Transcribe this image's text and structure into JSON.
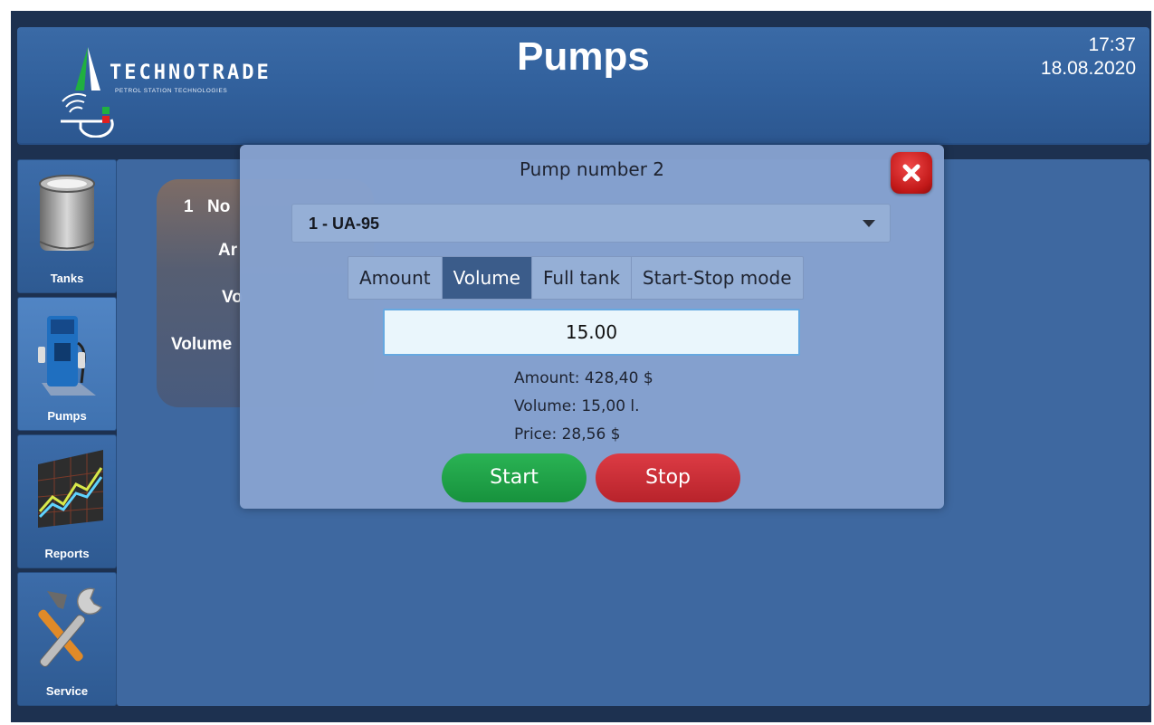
{
  "header": {
    "brand_name": "TECHNOTRADE",
    "brand_tagline": "PETROL STATION TECHNOLOGIES",
    "title": "Pumps",
    "time": "17:37",
    "date": "18.08.2020"
  },
  "sidebar": {
    "items": [
      {
        "label": "Tanks",
        "icon": "tank-icon"
      },
      {
        "label": "Pumps",
        "icon": "fuel-pump-icon",
        "active": true
      },
      {
        "label": "Reports",
        "icon": "chart-icon"
      },
      {
        "label": "Service",
        "icon": "tools-icon"
      }
    ]
  },
  "pump_card": {
    "number": "1",
    "nozzle_label": "No",
    "amount_label": "Ar",
    "volume_label": "Vo",
    "volume_label2": "Volume"
  },
  "dialog": {
    "title": "Pump number 2",
    "fuel_select": "1 - UA-95",
    "modes": [
      "Amount",
      "Volume",
      "Full tank",
      "Start-Stop mode"
    ],
    "selected_mode": "Volume",
    "input_value": "15.00",
    "summary": {
      "amount": "Amount: 428,40 $",
      "volume": "Volume: 15,00 l.",
      "price": "Price: 28,56 $"
    },
    "start_label": "Start",
    "stop_label": "Stop"
  },
  "colors": {
    "header_bg": "#3a6aa6",
    "main_bg": "#3e68a0",
    "dialog_bg": "#86a2cf",
    "start": "#20a848",
    "stop": "#cc2f38",
    "close": "#d62222",
    "nozzle_highlight": "#ffff33"
  }
}
